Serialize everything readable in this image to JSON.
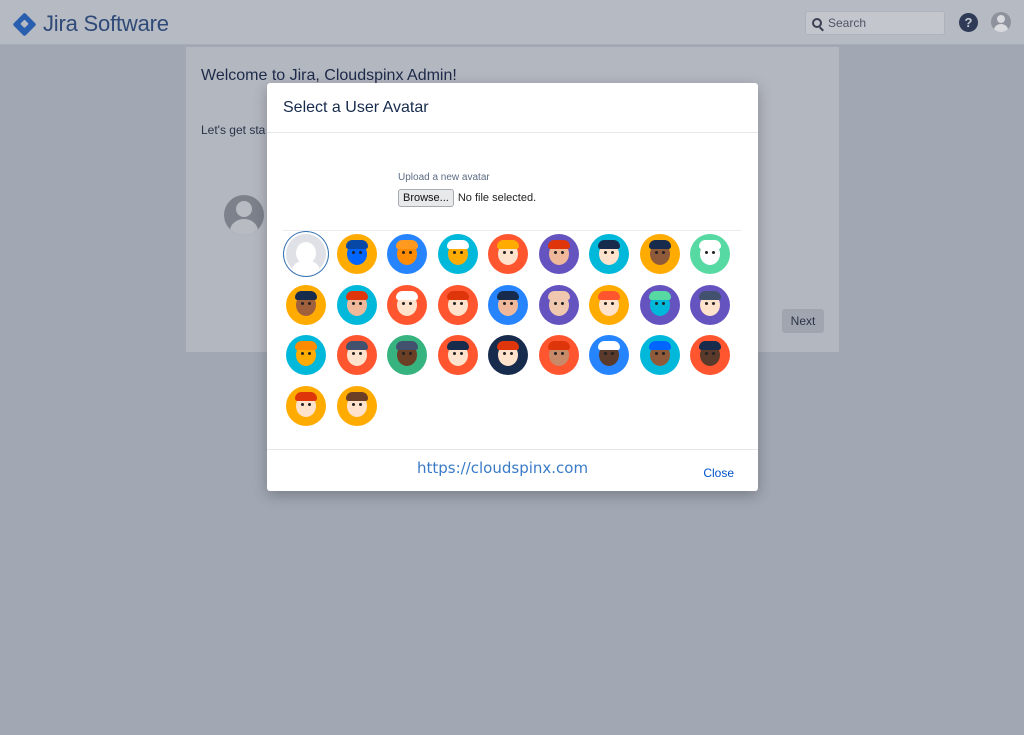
{
  "header": {
    "app_name": "Jira Software",
    "search_placeholder": "Search",
    "help_glyph": "?"
  },
  "background_page": {
    "title": "Welcome to Jira, Cloudspinx Admin!",
    "intro": "Let's get sta",
    "next_label": "Next"
  },
  "modal": {
    "title": "Select a User Avatar",
    "upload_label": "Upload a new avatar",
    "browse_label": "Browse...",
    "file_status": "No file selected.",
    "watermark": "https://cloudspinx.com",
    "close_label": "Close"
  },
  "avatars": [
    {
      "bg": "#dfe1e6",
      "skin": "#ffffff",
      "hair": "#dfe1e6",
      "name": "default-avatar"
    },
    {
      "bg": "#ffab00",
      "skin": "#0065ff",
      "hair": "#0747a6",
      "name": "blue-mask-avatar"
    },
    {
      "bg": "#2684ff",
      "skin": "#ff8b00",
      "hair": "#ff991f",
      "name": "cat-avatar"
    },
    {
      "bg": "#00b8d9",
      "skin": "#ffab00",
      "hair": "#ffffff",
      "name": "dog-avatar"
    },
    {
      "bg": "#ff5630",
      "skin": "#ffe2cc",
      "hair": "#ffab00",
      "name": "blond-avatar"
    },
    {
      "bg": "#6554c0",
      "skin": "#f0b89a",
      "hair": "#de350b",
      "name": "gnome-avatar"
    },
    {
      "bg": "#00b8d9",
      "skin": "#ffe2cc",
      "hair": "#172b4d",
      "name": "dark-hair-avatar"
    },
    {
      "bg": "#ffab00",
      "skin": "#8f5a3a",
      "hair": "#172b4d",
      "name": "curly-avatar"
    },
    {
      "bg": "#57d9a3",
      "skin": "#ffffff",
      "hair": "#ffffff",
      "name": "ghost-avatar"
    },
    {
      "bg": "#ffab00",
      "skin": "#a0603c",
      "hair": "#172b4d",
      "name": "flat-top-avatar"
    },
    {
      "bg": "#00b8d9",
      "skin": "#f0b89a",
      "hair": "#de350b",
      "name": "santa-avatar"
    },
    {
      "bg": "#ff5630",
      "skin": "#ffe2cc",
      "hair": "#ffffff",
      "name": "chef-avatar"
    },
    {
      "bg": "#ff5630",
      "skin": "#ffe2cc",
      "hair": "#de350b",
      "name": "redhead-avatar"
    },
    {
      "bg": "#2684ff",
      "skin": "#f0b89a",
      "hair": "#172b4d",
      "name": "short-hair-avatar"
    },
    {
      "bg": "#6554c0",
      "skin": "#f0c8b0",
      "hair": "#f0c8b0",
      "name": "bald-avatar"
    },
    {
      "bg": "#ffab00",
      "skin": "#ffe2cc",
      "hair": "#ff5630",
      "name": "bearded-avatar"
    },
    {
      "bg": "#6554c0",
      "skin": "#00b8d9",
      "hair": "#57d9a3",
      "name": "owl-avatar"
    },
    {
      "bg": "#6554c0",
      "skin": "#ffe2cc",
      "hair": "#42526e",
      "name": "captain-avatar"
    },
    {
      "bg": "#00b8d9",
      "skin": "#ffab00",
      "hair": "#ff8b00",
      "name": "robot-avatar"
    },
    {
      "bg": "#ff5630",
      "skin": "#ffe2cc",
      "hair": "#42526e",
      "name": "mustache-avatar"
    },
    {
      "bg": "#36b37e",
      "skin": "#6b3e26",
      "hair": "#42526e",
      "name": "afro-avatar"
    },
    {
      "bg": "#ff5630",
      "skin": "#ffe2cc",
      "hair": "#172b4d",
      "name": "long-hair-avatar"
    },
    {
      "bg": "#172b4d",
      "skin": "#ffe2cc",
      "hair": "#de350b",
      "name": "red-bob-avatar"
    },
    {
      "bg": "#ff5630",
      "skin": "#c98a6a",
      "hair": "#de350b",
      "name": "hijab-avatar"
    },
    {
      "bg": "#2684ff",
      "skin": "#5a3a2a",
      "hair": "#ffffff",
      "name": "white-hood-avatar"
    },
    {
      "bg": "#00b8d9",
      "skin": "#8f5a3a",
      "hair": "#0065ff",
      "name": "turban-avatar"
    },
    {
      "bg": "#ff5630",
      "skin": "#5a3a2a",
      "hair": "#172b4d",
      "name": "beard-avatar"
    },
    {
      "bg": "#ffab00",
      "skin": "#ffe2cc",
      "hair": "#de350b",
      "name": "red-long-hair-avatar"
    },
    {
      "bg": "#ffab00",
      "skin": "#ffe2cc",
      "hair": "#6b3e26",
      "name": "brunette-avatar"
    }
  ]
}
